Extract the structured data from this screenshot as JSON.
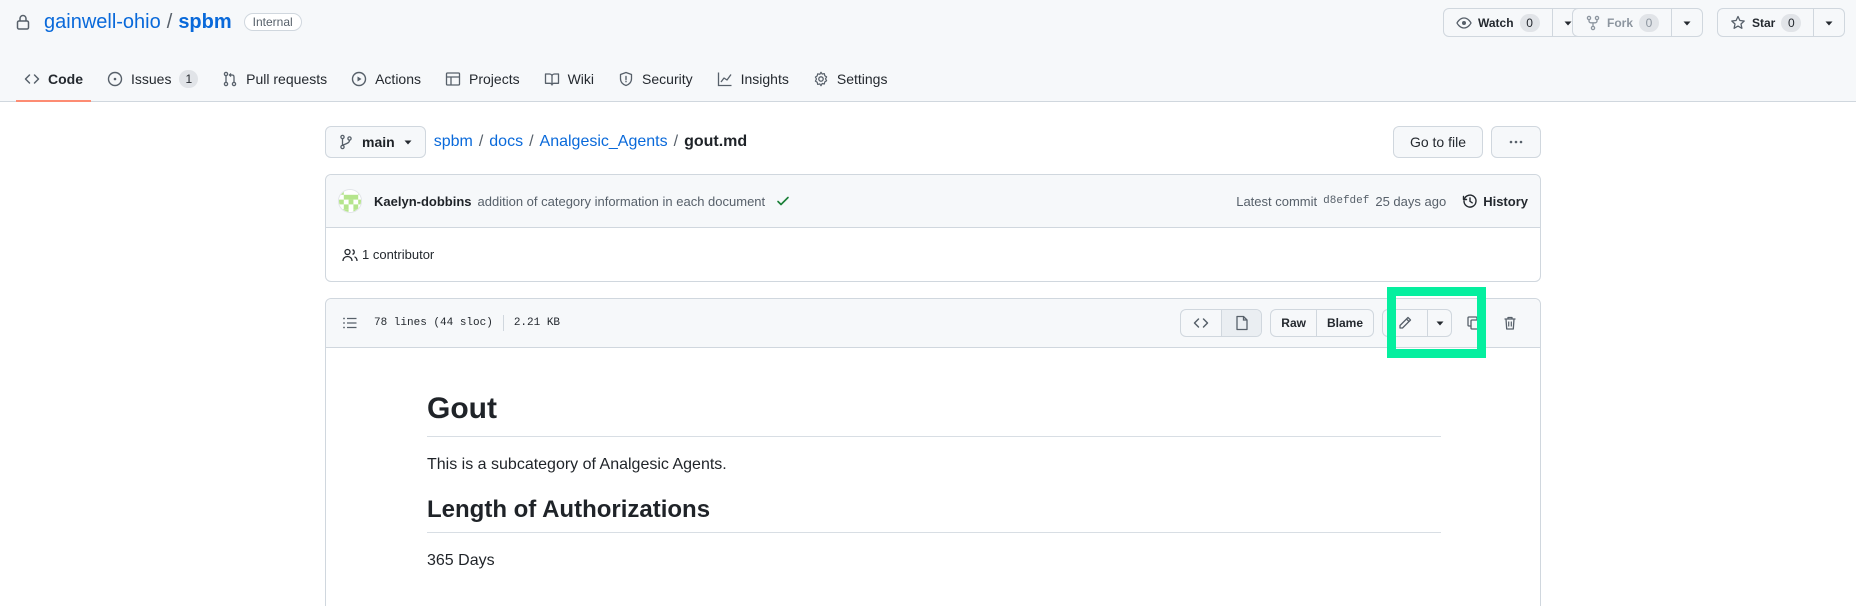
{
  "repo": {
    "owner": "gainwell-ohio",
    "separator": "/",
    "name": "spbm",
    "visibility": "Internal"
  },
  "repo_actions": {
    "watch": {
      "label": "Watch",
      "count": "0"
    },
    "fork": {
      "label": "Fork",
      "count": "0"
    },
    "star": {
      "label": "Star",
      "count": "0"
    }
  },
  "tabs": [
    {
      "label": "Code",
      "icon": "code-icon",
      "active": true
    },
    {
      "label": "Issues",
      "icon": "issue-opened-icon",
      "count": "1"
    },
    {
      "label": "Pull requests",
      "icon": "git-pull-request-icon"
    },
    {
      "label": "Actions",
      "icon": "play-icon"
    },
    {
      "label": "Projects",
      "icon": "table-icon"
    },
    {
      "label": "Wiki",
      "icon": "book-icon"
    },
    {
      "label": "Security",
      "icon": "shield-icon"
    },
    {
      "label": "Insights",
      "icon": "graph-icon"
    },
    {
      "label": "Settings",
      "icon": "gear-icon"
    }
  ],
  "branch": {
    "name": "main"
  },
  "breadcrumb": {
    "parts": [
      "spbm",
      "docs",
      "Analgesic_Agents"
    ],
    "separator": "/",
    "current": "gout.md"
  },
  "file_actions": {
    "go_to_file": "Go to file",
    "more": "···"
  },
  "commit": {
    "author": "Kaelyn-dobbins",
    "message": "addition of category information in each document",
    "latest_label": "Latest commit",
    "sha": "d8efdef",
    "age": "25 days ago",
    "history_label": "History",
    "contributors": "1 contributor"
  },
  "file": {
    "lines": "78 lines (44 sloc)",
    "size": "2.21 KB",
    "raw_label": "Raw",
    "blame_label": "Blame"
  },
  "markdown": {
    "h1": "Gout",
    "intro": "This is a subcategory of Analgesic Agents.",
    "h2": "Length of Authorizations",
    "duration": "365 Days"
  },
  "colors": {
    "accent_link": "#0969da",
    "active_tab_underline": "#fd8c73",
    "highlight_box": "#05ef9f",
    "check_green": "#1a7f37"
  }
}
